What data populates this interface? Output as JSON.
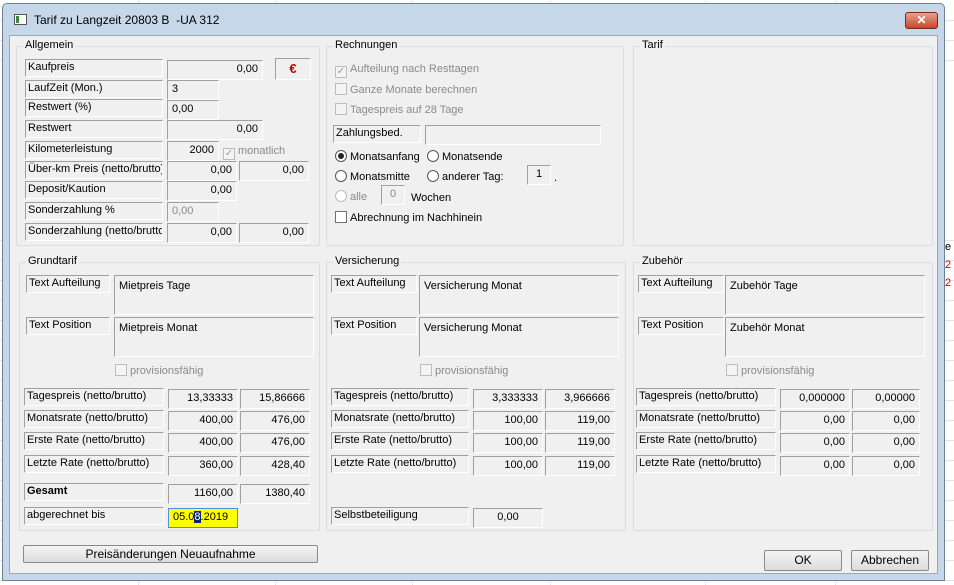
{
  "window": {
    "title": "Tarif zu Langzeit 20803 B  -UA 312",
    "close_label": "✕"
  },
  "background": {
    "red_marks": [
      "2",
      "2"
    ],
    "e_mark": "e"
  },
  "allgemein": {
    "title": "Allgemein",
    "kaufpreis_label": "Kaufpreis",
    "kaufpreis_value": "0,00",
    "currency_symbol": "€",
    "laufzeit_label": "LaufZeit (Mon.)",
    "laufzeit_value": "3",
    "restwert_pct_label": "Restwert (%)",
    "restwert_pct_value": "0,00",
    "restwert_label": "Restwert",
    "restwert_value": "0,00",
    "km_label": "Kilometerleistung",
    "km_value": "2000",
    "monatlich_label": "monatlich",
    "monatlich_checked": true,
    "ueberkm_label": "Über-km Preis (netto/brutto)",
    "ueberkm_netto": "0,00",
    "ueberkm_brutto": "0,00",
    "deposit_label": "Deposit/Kaution",
    "deposit_value": "0,00",
    "sonder_pct_label": "Sonderzahlung %",
    "sonder_pct_value": "0,00",
    "sonder_label": "Sonderzahlung (netto/brutto)",
    "sonder_netto": "0,00",
    "sonder_brutto": "0,00"
  },
  "rechnungen": {
    "title": "Rechnungen",
    "aufteilung_label": "Aufteilung nach Resttagen",
    "aufteilung_checked": true,
    "ganze_monate_label": "Ganze Monate berechnen",
    "tagespreis28_label": "Tagespreis auf 28 Tage",
    "zahlungsbed_label": "Zahlungsbed.",
    "zahlungsbed_value": "",
    "monatsanfang_label": "Monatsanfang",
    "monatsende_label": "Monatsende",
    "monatsmitte_label": "Monatsmitte",
    "anderer_tag_label": "anderer Tag:",
    "anderer_tag_value": "1",
    "anderer_tag_suffix": ".",
    "alle_label": "alle",
    "alle_value": "0",
    "wochen_label": "Wochen",
    "nachhinein_label": "Abrechnung im Nachhinein"
  },
  "tarif": {
    "title": "Tarif"
  },
  "grundtarif": {
    "title": "Grundtarif",
    "text_aufteilung_label": "Text Aufteilung",
    "text_aufteilung_value": "Mietpreis Tage",
    "text_position_label": "Text Position",
    "text_position_value": "Mietpreis Monat",
    "provision_label": "provisionsfähig",
    "rows": [
      {
        "label": "Tagespreis (netto/brutto)",
        "netto": "13,33333",
        "brutto": "15,86666"
      },
      {
        "label": "Monatsrate (netto/brutto)",
        "netto": "400,00",
        "brutto": "476,00"
      },
      {
        "label": "Erste Rate (netto/brutto)",
        "netto": "400,00",
        "brutto": "476,00"
      },
      {
        "label": "Letzte Rate (netto/brutto)",
        "netto": "360,00",
        "brutto": "428,40"
      }
    ],
    "gesamt_label": "Gesamt",
    "gesamt_netto": "1160,00",
    "gesamt_brutto": "1380,40",
    "abgerechnet_label": "abgerechnet bis",
    "abgerechnet_pre": "05.0",
    "abgerechnet_sel": "8",
    "abgerechnet_post": ".2019"
  },
  "versicherung": {
    "title": "Versicherung",
    "text_aufteilung_label": "Text Aufteilung",
    "text_aufteilung_value": "Versicherung Monat",
    "text_position_label": "Text Position",
    "text_position_value": "Versicherung Monat",
    "provision_label": "provisionsfähig",
    "rows": [
      {
        "label": "Tagespreis (netto/brutto)",
        "netto": "3,333333",
        "brutto": "3,966666"
      },
      {
        "label": "Monatsrate (netto/brutto)",
        "netto": "100,00",
        "brutto": "119,00"
      },
      {
        "label": "Erste Rate (netto/brutto)",
        "netto": "100,00",
        "brutto": "119,00"
      },
      {
        "label": "Letzte Rate (netto/brutto)",
        "netto": "100,00",
        "brutto": "119,00"
      }
    ],
    "selbst_label": "Selbstbeteiligung",
    "selbst_value": "0,00"
  },
  "zubehoer": {
    "title": "Zubehör",
    "text_aufteilung_label": "Text Aufteilung",
    "text_aufteilung_value": "Zubehör Tage",
    "text_position_label": "Text Position",
    "text_position_value": "Zubehör Monat",
    "provision_label": "provisionsfähig",
    "rows": [
      {
        "label": "Tagespreis (netto/brutto)",
        "netto": "0,000000",
        "brutto": "0,00000"
      },
      {
        "label": "Monatsrate (netto/brutto)",
        "netto": "0,00",
        "brutto": "0,00"
      },
      {
        "label": "Erste Rate (netto/brutto)",
        "netto": "0,00",
        "brutto": "0,00"
      },
      {
        "label": "Letzte Rate (netto/brutto)",
        "netto": "0,00",
        "brutto": "0,00"
      }
    ]
  },
  "buttons": {
    "preis_label": "Preisänderungen Neuaufnahme",
    "ok_label": "OK",
    "cancel_label": "Abbrechen"
  }
}
